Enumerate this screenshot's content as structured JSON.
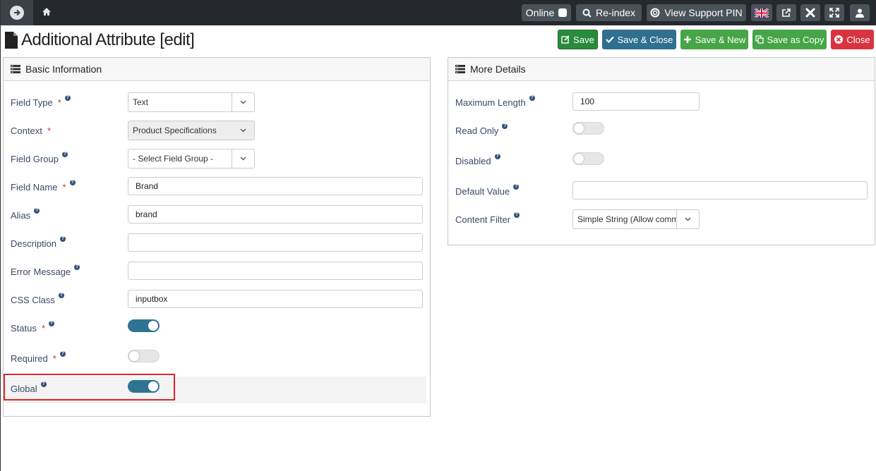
{
  "topbar": {
    "online_label": "Online",
    "reindex_label": "Re-index",
    "support_pin_label": "View Support PIN"
  },
  "page": {
    "title": "Additional Attribute [edit]"
  },
  "toolbar": {
    "save": "Save",
    "save_close": "Save & Close",
    "save_new": "Save & New",
    "save_copy": "Save as Copy",
    "close": "Close"
  },
  "basic": {
    "title": "Basic Information",
    "field_type": {
      "label": "Field Type",
      "value": "Text",
      "required": "*"
    },
    "context": {
      "label": "Context",
      "value": "Product Specifications",
      "required": "*"
    },
    "field_group": {
      "label": "Field Group",
      "value": "- Select Field Group -"
    },
    "field_name": {
      "label": "Field Name",
      "value": "Brand",
      "required": "*"
    },
    "alias": {
      "label": "Alias",
      "value": "brand"
    },
    "description": {
      "label": "Description",
      "value": ""
    },
    "error_message": {
      "label": "Error Message",
      "value": ""
    },
    "css_class": {
      "label": "CSS Class",
      "value": "inputbox"
    },
    "status": {
      "label": "Status",
      "on": true,
      "required": "*"
    },
    "required": {
      "label": "Required",
      "on": false,
      "required": "*"
    },
    "global": {
      "label": "Global",
      "on": true
    }
  },
  "details": {
    "title": "More Details",
    "max_length": {
      "label": "Maximum Length",
      "value": "100"
    },
    "read_only": {
      "label": "Read Only",
      "on": false
    },
    "disabled": {
      "label": "Disabled",
      "on": false
    },
    "default_value": {
      "label": "Default Value",
      "value": ""
    },
    "content_filter": {
      "label": "Content Filter",
      "value": "Simple String (Allow common"
    }
  },
  "colors": {
    "topbar": "#25292d",
    "toggle_on": "#2e7392",
    "save": "#2a8a3c",
    "save_close": "#2f6f8f",
    "green": "#46a546",
    "close": "#d9333f",
    "highlight": "#e0262b"
  }
}
